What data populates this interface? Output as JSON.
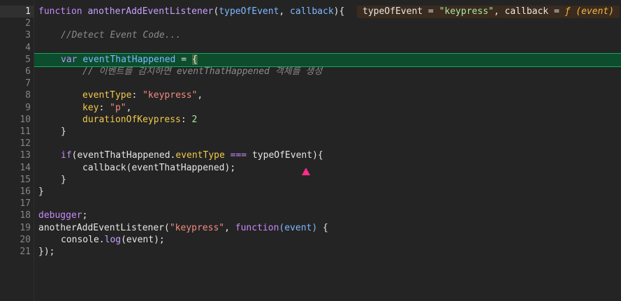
{
  "gutter": [
    "1",
    "2",
    "3",
    "4",
    "5",
    "6",
    "7",
    "8",
    "9",
    "10",
    "11",
    "12",
    "13",
    "14",
    "15",
    "16",
    "17",
    "18",
    "19",
    "20",
    "21"
  ],
  "code": {
    "l1": {
      "kw": "function",
      "name": "anotherAddEventListener",
      "open": "(",
      "p1": "typeOfEvent",
      ", ": ", ",
      "p2": "callback",
      "close": "){"
    },
    "l3": "//Detect Event Code...",
    "l5": {
      "kw": "var",
      "name": "eventThatHappened",
      "eq": " = ",
      "brace": "{"
    },
    "l6": "// 이벤트를 감지하면 eventThatHappened 객체를 생성",
    "l8": {
      "key": "eventType",
      ":": ": ",
      "val": "\"keypress\"",
      "comma": ","
    },
    "l9": {
      "key": "key",
      ":": ": ",
      "val": "\"p\"",
      "comma": ","
    },
    "l10": {
      "key": "durationOfKeypress",
      ":": ": ",
      "val": "2"
    },
    "l11": "}",
    "l13": {
      "kw": "if",
      "open": "(",
      "obj": "eventThatHappened",
      ".": ".",
      "prop": "eventType",
      "op": " === ",
      "rhs": "typeOfEvent",
      "close": "){"
    },
    "l14": {
      "call": "callback",
      "arg": "(eventThatHappened);"
    },
    "l15": "}",
    "l16": "}",
    "l18": {
      "kw": "debugger",
      ";": ";"
    },
    "l19": {
      "name": "anotherAddEventListener",
      "open": "(",
      "str": "\"keypress\"",
      "comma": ", ",
      "kw": "function",
      "p": "(event)",
      "tail": " {"
    },
    "l20": {
      "obj": "console",
      ".": ".",
      "method": "log",
      "args": "(event);"
    },
    "l21": "});"
  },
  "tooltip": {
    "a": "typeOfEvent = ",
    "b": "\"keypress\"",
    "c": ", callback = ",
    "d": "ƒ (event)"
  }
}
